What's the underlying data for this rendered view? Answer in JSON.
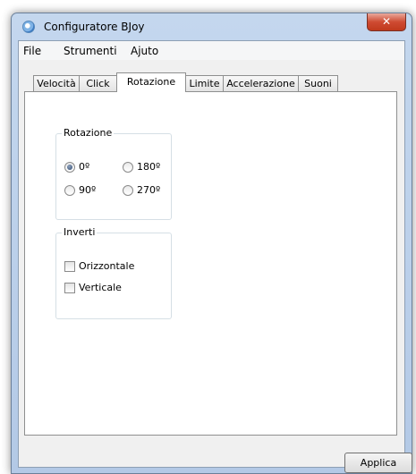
{
  "window": {
    "title": "Configuratore BJoy",
    "close_glyph": "✕"
  },
  "menu": {
    "items": [
      "File",
      "Strumenti",
      "Ajuto"
    ]
  },
  "tabs": [
    "Velocità",
    "Click",
    "Rotazione",
    "Limite",
    "Accelerazione",
    "Suoni"
  ],
  "active_tab": "Rotazione",
  "rotation_group": {
    "label": "Rotazione",
    "options": [
      "0º",
      "180º",
      "90º",
      "270º"
    ],
    "selected": "0º"
  },
  "invert_group": {
    "label": "Inverti",
    "options": [
      "Orizzontale",
      "Verticale"
    ],
    "checked": []
  },
  "preview": {
    "blue_marker_color": "#16a6e5",
    "blue_ring_color": "#8fc8ea",
    "red_marker_color": "#d41d2f"
  },
  "footer": {
    "apply_label": "Applica"
  }
}
